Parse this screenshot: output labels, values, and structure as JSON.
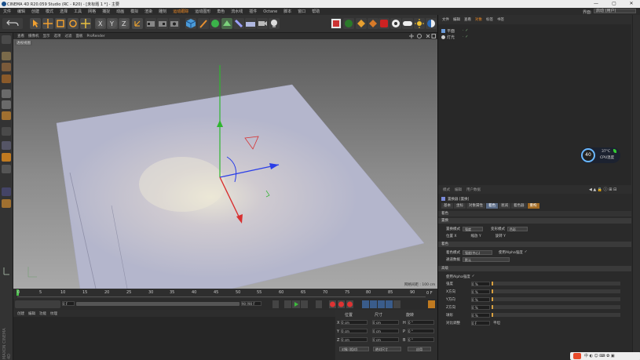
{
  "window": {
    "title": "CINEMA 4D R20.059 Studio (RC - R20) - [未标题 1 *] - 主要"
  },
  "menubar": [
    "文件",
    "编辑",
    "创建",
    "模式",
    "选择",
    "工具",
    "网格",
    "捕捉",
    "动画",
    "模拟",
    "渲染",
    "雕刻",
    "运动跟踪",
    "运动图形",
    "角色",
    "流水线",
    "插件",
    "Octane",
    "脚本",
    "窗口",
    "帮助"
  ],
  "menubar_highlight_index": 12,
  "layout_label": "界面:",
  "layout_value": "启动 (用户)",
  "viewport": {
    "menu": [
      "查看",
      "摄像机",
      "显示",
      "选项",
      "过滤",
      "面板",
      "ProRender"
    ],
    "camera_label": "透视视图",
    "grid_info": "网格间距 : 100 cm"
  },
  "timeline": {
    "ticks": [
      "0",
      "5",
      "10",
      "15",
      "20",
      "25",
      "30",
      "35",
      "40",
      "45",
      "50",
      "55",
      "60",
      "65",
      "70",
      "75",
      "80",
      "85",
      "90"
    ],
    "frame_end": "0 F"
  },
  "playbar": {
    "current": "0 F",
    "start": "0 F",
    "end": "90 F",
    "end2": "90 F"
  },
  "material_tabs": [
    "创建",
    "编辑",
    "功能",
    "纹理"
  ],
  "coords": {
    "headers": [
      "位置",
      "尺寸",
      "旋转"
    ],
    "rows": [
      {
        "axis": "X",
        "pos": "0 cm",
        "size": "0 cm",
        "rlabel": "H",
        "rot": "0 °"
      },
      {
        "axis": "Y",
        "pos": "0 cm",
        "size": "0 cm",
        "rlabel": "P",
        "rot": "0 °"
      },
      {
        "axis": "Z",
        "pos": "0 cm",
        "size": "0 cm",
        "rlabel": "B",
        "rot": "0 °"
      }
    ],
    "mode1": "对象 (相对)",
    "mode2": "绝对尺寸",
    "apply": "应用"
  },
  "object_manager": {
    "tabs": [
      "文件",
      "编辑",
      "查看",
      "对象",
      "标签",
      "书签"
    ],
    "objects": [
      "平面",
      "灯光"
    ]
  },
  "attributes": {
    "menu": [
      "模式",
      "编辑",
      "用户数据"
    ],
    "title": "置换器 [置换]",
    "tabs": [
      "基本",
      "坐标",
      "对象属性",
      "着色",
      "衰减",
      "着色器",
      "重构",
      "摄像机"
    ],
    "active_tab_index": 3,
    "section0": "着色",
    "subtitle": "着色",
    "s1_title": "置换",
    "s1_row1_label": "置换模式",
    "s1_row1_value": "强度",
    "s1_row1_label2": "变形模式",
    "s1_row1_value2": "色彩",
    "s1_row2a": "位置 X",
    "s1_row2b": "缩放 Y",
    "s1_row2c": "旋转 Y",
    "s2_title": "着色",
    "s2_row1_label": "着色模式",
    "s2_row1_value": "强度(中心)",
    "s2_row1_label2": "使用Alpha强度",
    "s2_row2_label": "通道数据",
    "s2_row2_value": "默认",
    "s3_title": "高级",
    "s3_check": "使用Alpha强度",
    "sliders": [
      {
        "label": "强度",
        "value": "0 %"
      },
      {
        "label": "X方向",
        "value": "0 %"
      },
      {
        "label": "Y方向",
        "value": "0 %"
      },
      {
        "label": "Z方向",
        "value": "0 %"
      },
      {
        "label": "球形",
        "value": "0 %"
      }
    ],
    "tail_label": "对比调整",
    "tail_value": "0 F",
    "tail_label2": "平坦"
  },
  "cpu_widget": {
    "percent": "40",
    "temp": "37°C",
    "label": "CPU温度"
  },
  "colors": {
    "accent": "#f08a24",
    "active_tab": "#5a6b86"
  }
}
